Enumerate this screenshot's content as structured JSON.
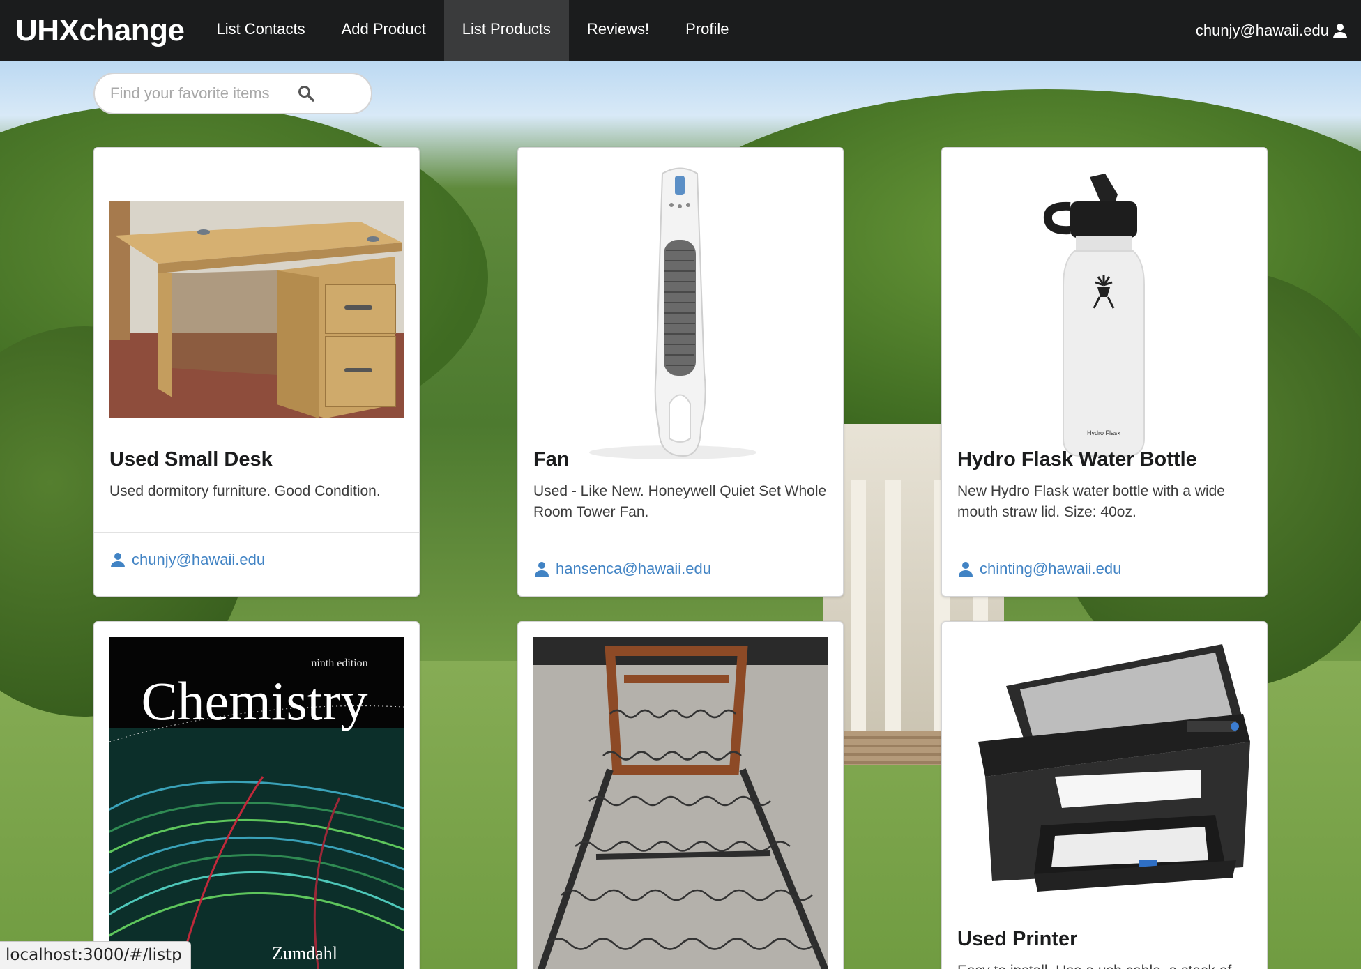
{
  "navbar": {
    "brand": "UHXchange",
    "items": [
      {
        "label": "List Contacts"
      },
      {
        "label": "Add Product"
      },
      {
        "label": "List Products",
        "active": true
      },
      {
        "label": "Reviews!"
      },
      {
        "label": "Profile"
      }
    ],
    "user_email": "chunjy@hawaii.edu",
    "user_icon": "user-icon"
  },
  "search": {
    "placeholder": "Find your favorite items",
    "value": "",
    "icon": "search-icon"
  },
  "products": [
    {
      "title": "Used Small Desk",
      "description": "Used dormitory furniture. Good Condition.",
      "owner": "chunjy@hawaii.edu",
      "image": "desk"
    },
    {
      "title": "Fan",
      "description": "Used - Like New. Honeywell Quiet Set Whole Room Tower Fan.",
      "owner": "hansenca@hawaii.edu",
      "image": "tower-fan"
    },
    {
      "title": "Hydro Flask Water Bottle",
      "description": "New Hydro Flask water bottle with a wide mouth straw lid. Size: 40oz.",
      "owner": "chinting@hawaii.edu",
      "image": "water-bottle",
      "image_text": "Hydro Flask"
    },
    {
      "title": "",
      "description": "",
      "owner": "",
      "image": "chemistry-book",
      "image_text_edition": "ninth edition",
      "image_text_title": "Chemistry",
      "image_text_author": "Zumdahl"
    },
    {
      "title": "",
      "description": "",
      "owner": "",
      "image": "bed-frame"
    },
    {
      "title": "Used Printer",
      "description": "Easy to install. Use a usb cable, a stack of",
      "owner": "",
      "image": "printer"
    }
  ],
  "status_bar": {
    "url": "localhost:3000/#/listp"
  },
  "colors": {
    "navbar": "#1b1c1d",
    "link": "#4183c4",
    "active_tab": "#3a3b3c"
  }
}
